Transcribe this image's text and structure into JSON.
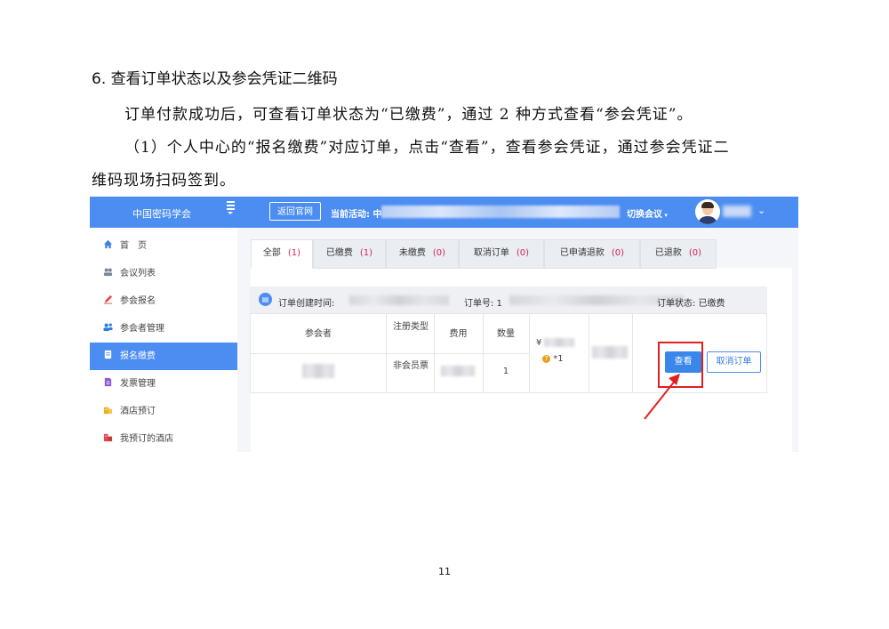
{
  "document": {
    "heading": "6. 查看订单状态以及参会凭证二维码",
    "paragraph1": "订单付款成功后，可查看订单状态为“已缴费”，通过 2 种方式查看“参会凭证”。",
    "paragraph2_line1": "（1）个人中心的“报名缴费”对应订单，点击“查看”，查看参会凭证，通过参会凭证二",
    "paragraph2_line2": "维码现场扫码签到。",
    "page_number": "11"
  },
  "screenshot": {
    "topbar": {
      "site_name": "中国密码学会",
      "back_button": "返回官网",
      "current_activity_label": "当前活动: 中",
      "switch_conference": "切换会议",
      "colors": {
        "bar": "#4b8df0"
      }
    },
    "sidebar": {
      "items": [
        {
          "label": "首　页",
          "icon": "home-icon",
          "color": "#3d7ee8"
        },
        {
          "label": "会议列表",
          "icon": "people-icon",
          "color": "#7a8797"
        },
        {
          "label": "参会报名",
          "icon": "pen-icon",
          "color": "#e04848"
        },
        {
          "label": "参会者管理",
          "icon": "users-icon",
          "color": "#2d7de0"
        },
        {
          "label": "报名缴费",
          "icon": "document-icon",
          "color": "#ffffff",
          "active": true
        },
        {
          "label": "发票管理",
          "icon": "invoice-icon",
          "color": "#8a5ad9"
        },
        {
          "label": "酒店预订",
          "icon": "hotel-icon",
          "color": "#e8b020"
        },
        {
          "label": "我预订的酒店",
          "icon": "building-icon",
          "color": "#e04848"
        }
      ]
    },
    "tabs": [
      {
        "label": "全部",
        "count": "(1)",
        "active": true
      },
      {
        "label": "已缴费",
        "count": "(1)"
      },
      {
        "label": "未缴费",
        "count": "(0)"
      },
      {
        "label": "取消订单",
        "count": "(0)"
      },
      {
        "label": "已申请退款",
        "count": "(0)"
      },
      {
        "label": "已退款",
        "count": "(0)"
      }
    ],
    "order": {
      "created_label": "订单创建时间:",
      "number_label": "订单号: 1",
      "status_label": "订单状态: 已缴费",
      "columns": [
        "参会者",
        "注册类型",
        "费用",
        "数量"
      ],
      "row": {
        "type": "非会员票",
        "quantity": "1",
        "price_prefix": "¥",
        "multiplier": "*1"
      },
      "view_button": "查看",
      "cancel_button": "取消订单"
    }
  }
}
